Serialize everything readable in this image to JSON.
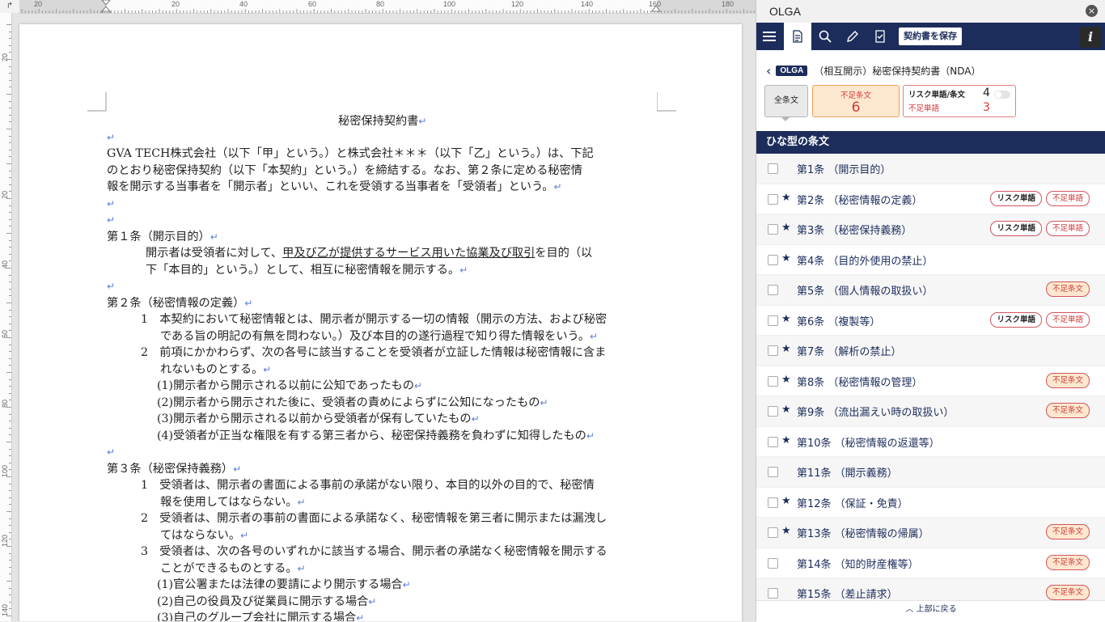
{
  "word": {
    "corner": "↱",
    "hruler_numbers": [
      "20",
      "20",
      "40",
      "60",
      "80",
      "100",
      "120",
      "140",
      "160",
      "180"
    ],
    "vruler_numbers": [
      "20",
      "20",
      "40",
      "60",
      "80",
      "100",
      "120",
      "140"
    ],
    "document": {
      "title": "秘密保持契約書",
      "preamble": [
        "GVA TECH株式会社（以下「甲」という。）と株式会社＊＊＊（以下「乙」という。）は、下記",
        "のとおり秘密保持契約（以下「本契約」という。）を締結する。なお、第２条に定める秘密情",
        "報を開示する当事者を「開示者」といい、これを受領する当事者を「受領者」という。"
      ],
      "a1_heading": "第１条（開示目的）",
      "a1_l1_pre": "開示者は受領者に対して、",
      "a1_l1_u": "甲及び乙が提供するサービス用いた協業及び取引",
      "a1_l1_post": "を目的（以",
      "a1_l2": "下「本目的」という。）として、相互に秘密情報を開示する。",
      "a2_heading": "第２条（秘密情報の定義）",
      "a2_lines": [
        "1　本契約において秘密情報とは、開示者が開示する一切の情報（開示の方法、および秘密",
        "である旨の明記の有無を問わない。）及び本目的の遂行過程で知り得た情報をいう。",
        "2　前項にかかわらず、次の各号に該当することを受領者が立証した情報は秘密情報に含ま",
        "れないものとする。",
        "(1)開示者から開示される以前に公知であったもの",
        "(2)開示者から開示された後に、受領者の責めによらずに公知になったもの",
        "(3)開示者から開示される以前から受領者が保有していたもの",
        "(4)受領者が正当な権限を有する第三者から、秘密保持義務を負わずに知得したもの"
      ],
      "a3_heading": "第３条（秘密保持義務）",
      "a3_lines": [
        "1　受領者は、開示者の書面による事前の承諾がない限り、本目的以外の目的で、秘密情",
        "報を使用してはならない。",
        "2　受領者は、開示者の事前の書面による承諾なく、秘密情報を第三者に開示または漏洩し",
        "てはならない。",
        "3　受領者は、次の各号のいずれかに該当する場合、開示者の承諾なく秘密情報を開示する",
        "ことができるものとする。",
        "(1)官公署または法律の要請により開示する場合",
        "(2)自己の役員及び従業員に開示する場合",
        "(3)自己のグループ会社に開示する場合"
      ],
      "para_mark": "↵"
    }
  },
  "olga": {
    "title": "OLGA",
    "close_label": "×",
    "save_button": "契約書を保存",
    "info_label": "i",
    "back_arrow": "‹",
    "badge": "OLGA",
    "contract_name": "（相互開示）秘密保持契約書（NDA）",
    "filters": {
      "all": "全条文",
      "missing_label": "不足条文",
      "missing_count": "6",
      "risk_label": "リスク単語/条文",
      "risk_count": "4",
      "missing_word_label": "不足単語",
      "missing_word_count": "3"
    },
    "section_header": "ひな型の条文",
    "clauses": [
      {
        "title": "第1条 （開示目的）",
        "star": false,
        "tags": []
      },
      {
        "title": "第2条 （秘密情報の定義）",
        "star": true,
        "tags": [
          "リスク単語",
          "不足単語"
        ]
      },
      {
        "title": "第3条 （秘密保持義務）",
        "star": true,
        "tags": [
          "リスク単語",
          "不足単語"
        ]
      },
      {
        "title": "第4条 （目的外使用の禁止）",
        "star": true,
        "tags": []
      },
      {
        "title": "第5条 （個人情報の取扱い）",
        "star": false,
        "tags": [
          "不足条文"
        ]
      },
      {
        "title": "第6条 （複製等）",
        "star": true,
        "tags": [
          "リスク単語",
          "不足単語"
        ]
      },
      {
        "title": "第7条 （解析の禁止）",
        "star": true,
        "tags": []
      },
      {
        "title": "第8条 （秘密情報の管理）",
        "star": true,
        "tags": [
          "不足条文"
        ]
      },
      {
        "title": "第9条 （流出漏えい時の取扱い）",
        "star": true,
        "tags": [
          "不足条文"
        ]
      },
      {
        "title": "第10条 （秘密情報の返還等）",
        "star": true,
        "tags": []
      },
      {
        "title": "第11条 （開示義務）",
        "star": false,
        "tags": []
      },
      {
        "title": "第12条 （保証・免責）",
        "star": true,
        "tags": []
      },
      {
        "title": "第13条 （秘密情報の帰属）",
        "star": true,
        "tags": [
          "不足条文"
        ]
      },
      {
        "title": "第14条 （知的財産権等）",
        "star": false,
        "tags": [
          "不足条文"
        ]
      },
      {
        "title": "第15条 （差止請求）",
        "star": false,
        "tags": [
          "不足条文"
        ]
      }
    ],
    "back_to_top": "上部に戻る",
    "colors": {
      "navy": "#1c2d5c",
      "red": "#d23a3a",
      "missing_bg": "#fde8cf"
    }
  }
}
